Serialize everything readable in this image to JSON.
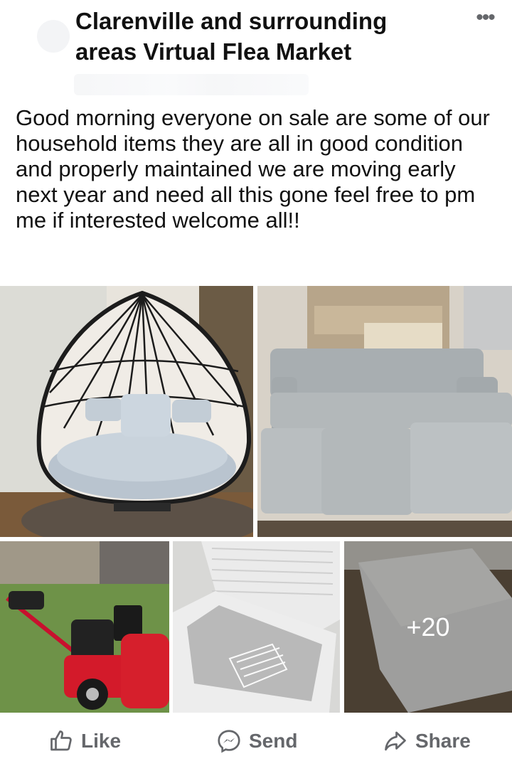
{
  "post": {
    "group_title": "Clarenville and surrounding areas Virtual Flea Market",
    "text": "Good morning everyone on sale are some of our household items they are all in good condition and properly maintained we are moving early next year and need all this gone feel free to pm me if interested welcome all!!",
    "more_photos_label": "+20"
  },
  "photos": [
    {
      "name": "hanging egg chair with grey cushion"
    },
    {
      "name": "grey sectional sofa"
    },
    {
      "name": "red snow blower"
    },
    {
      "name": "open white chest freezer with wire basket"
    },
    {
      "name": "closed white chest freezer"
    }
  ],
  "actions": {
    "like_label": "Like",
    "send_label": "Send",
    "share_label": "Share"
  },
  "colors": {
    "text": "#1c1e21",
    "action_gray": "#65676b",
    "background": "#ffffff"
  }
}
